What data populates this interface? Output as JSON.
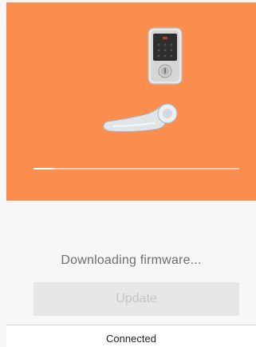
{
  "hero": {
    "background_color": "#fb8e4f",
    "device_image": "keypad-lock-icon",
    "handle_image": "lever-handle-icon"
  },
  "download": {
    "progress": 0.1,
    "message": "Downloading firmware..."
  },
  "actions": {
    "update_label": "Update",
    "update_enabled": false
  },
  "status_bar": {
    "connection": "Connected"
  }
}
